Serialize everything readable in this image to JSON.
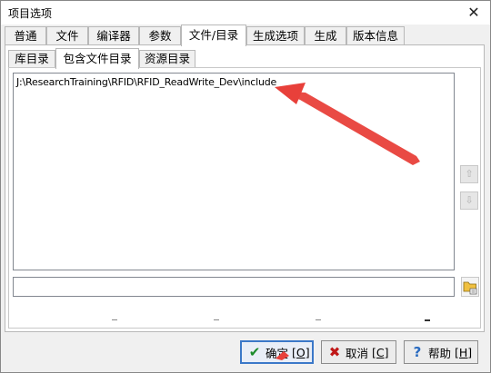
{
  "window": {
    "title": "项目选项",
    "close_glyph": "✕"
  },
  "tabs": [
    {
      "label": "普通"
    },
    {
      "label": "文件"
    },
    {
      "label": "编译器"
    },
    {
      "label": "参数"
    },
    {
      "label": "文件/目录",
      "active": true
    },
    {
      "label": "生成选项"
    },
    {
      "label": "生成"
    },
    {
      "label": "版本信息"
    }
  ],
  "subtabs": [
    {
      "label": "库目录"
    },
    {
      "label": "包含文件目录",
      "active": true
    },
    {
      "label": "资源目录"
    }
  ],
  "directory_list": {
    "items": [
      "J:\\ResearchTraining\\RFID\\RFID_ReadWrite_Dev\\include"
    ]
  },
  "path_input": {
    "value": ""
  },
  "side_buttons": {
    "up_icon": "arrow-up-icon",
    "down_icon": "arrow-down-icon"
  },
  "browse_icon": "folder-browse-icon",
  "buttons": {
    "ok": {
      "label": "确定",
      "hotkey": "[O]"
    },
    "cancel": {
      "label": "取消",
      "hotkey": "[C]"
    },
    "help": {
      "label": "帮助",
      "hotkey": "[H]"
    }
  },
  "colors": {
    "annotation_arrow": "#e8403a",
    "ok_icon": "#1a8a2a",
    "cancel_icon": "#c01818",
    "help_icon": "#2a6bc0"
  }
}
